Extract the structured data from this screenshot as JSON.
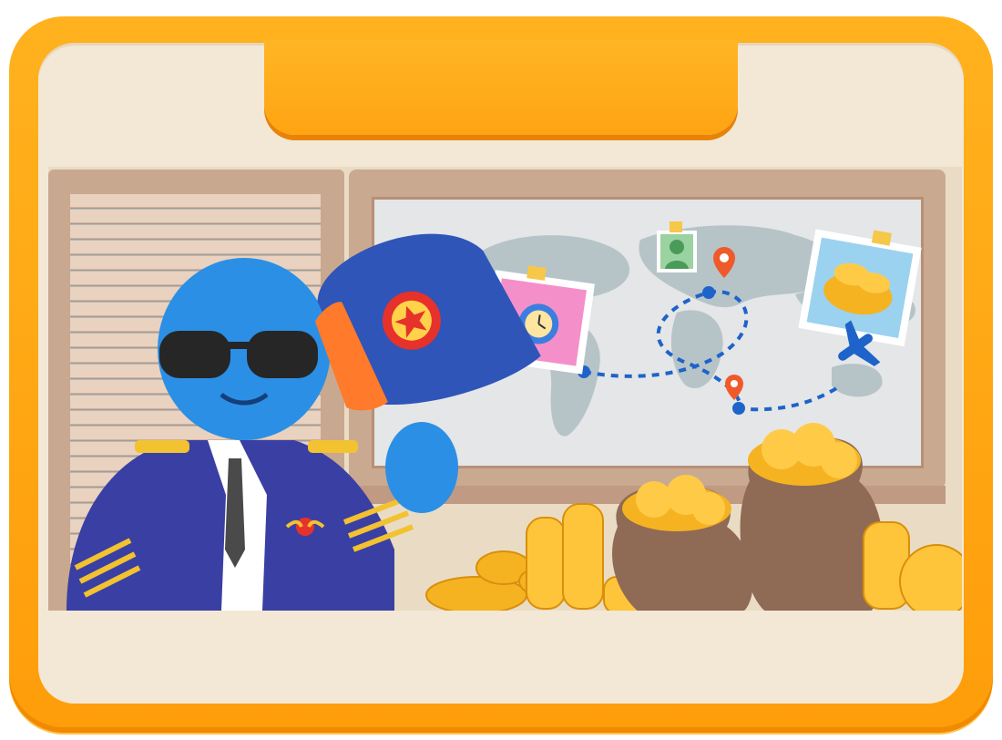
{
  "banner": {
    "title": ""
  },
  "colors": {
    "frame": "#ffa412",
    "panel": "#f3e8d5",
    "route": "#1e63c9",
    "pin": "#ef5a2a",
    "coin": "#f5b322",
    "character": "#2b8fe6",
    "suit": "#3a3fa3"
  },
  "map_icons": [
    "alarm-clock-photo",
    "person-photo",
    "coins-photo",
    "airplane-icon",
    "location-pin-icon"
  ]
}
